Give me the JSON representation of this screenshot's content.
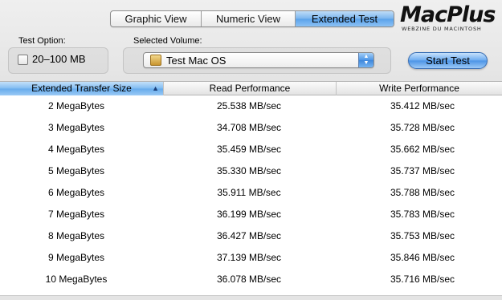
{
  "tabs": [
    {
      "label": "Graphic View",
      "active": false
    },
    {
      "label": "Numeric View",
      "active": false
    },
    {
      "label": "Extended Test",
      "active": true
    }
  ],
  "logo": {
    "main": "MacPlus",
    "sub": "WEBZINE DU MACINTOSH"
  },
  "test_option": {
    "label": "Test Option:",
    "checkbox_label": "20–100 MB",
    "checked": false
  },
  "volume": {
    "label": "Selected Volume:",
    "value": "Test Mac OS",
    "icon": "disk-icon"
  },
  "start_button": {
    "label": "Start Test"
  },
  "table": {
    "columns": [
      "Extended Transfer Size",
      "Read Performance",
      "Write Performance"
    ],
    "sorted_column": 0,
    "sort_direction": "ascending",
    "rows": [
      {
        "size": "2 MegaBytes",
        "read": "25.538 MB/sec",
        "write": "35.412 MB/sec"
      },
      {
        "size": "3 MegaBytes",
        "read": "34.708 MB/sec",
        "write": "35.728 MB/sec"
      },
      {
        "size": "4 MegaBytes",
        "read": "35.459 MB/sec",
        "write": "35.662 MB/sec"
      },
      {
        "size": "5 MegaBytes",
        "read": "35.330 MB/sec",
        "write": "35.737 MB/sec"
      },
      {
        "size": "6 MegaBytes",
        "read": "35.911 MB/sec",
        "write": "35.788 MB/sec"
      },
      {
        "size": "7 MegaBytes",
        "read": "36.199 MB/sec",
        "write": "35.783 MB/sec"
      },
      {
        "size": "8 MegaBytes",
        "read": "36.427 MB/sec",
        "write": "35.753 MB/sec"
      },
      {
        "size": "9 MegaBytes",
        "read": "37.139 MB/sec",
        "write": "35.846 MB/sec"
      },
      {
        "size": "10 MegaBytes",
        "read": "36.078 MB/sec",
        "write": "35.716 MB/sec"
      }
    ]
  },
  "colors": {
    "accent": "#66abec",
    "toolbar": "#e8e8e8"
  }
}
